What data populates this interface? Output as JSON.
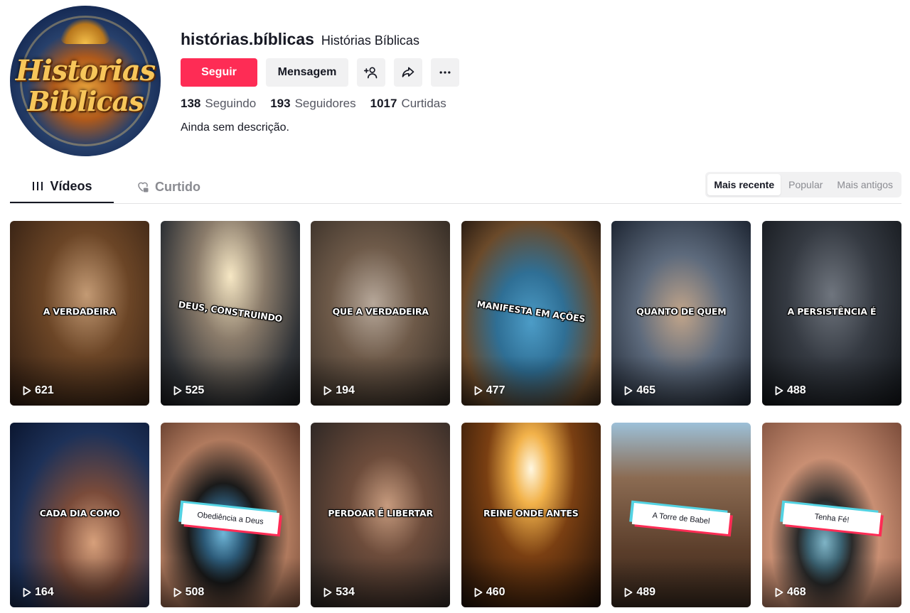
{
  "profile": {
    "username": "histórias.bíblicas",
    "nickname": "Histórias Bíblicas",
    "avatar_text_line1": "Historias",
    "avatar_text_line2": "Biblicas",
    "follow_label": "Seguir",
    "message_label": "Mensagem",
    "stats": {
      "following_count": "138",
      "following_label": "Seguindo",
      "followers_count": "193",
      "followers_label": "Seguidores",
      "likes_count": "1017",
      "likes_label": "Curtidas"
    },
    "bio": "Ainda sem descrição."
  },
  "tabs": {
    "videos": "Vídeos",
    "liked": "Curtido"
  },
  "sort": {
    "options": [
      "Mais recente",
      "Popular",
      "Mais antigos"
    ],
    "selected": "Mais recente"
  },
  "icons": {
    "add_friend": "add-friend-icon",
    "share": "share-icon",
    "more": "more-icon",
    "videos_tab": "grid-icon",
    "liked_tab": "heart-lock-icon",
    "play": "play-icon"
  },
  "colors": {
    "accent": "#fe2c55",
    "secondary_button": "#f1f1f2",
    "text_primary": "#161823",
    "text_secondary": "#8a8b91"
  },
  "videos": [
    {
      "caption": "A VERDADEIRA",
      "views": "621"
    },
    {
      "caption": "DEUS, CONSTRUINDO",
      "views": "525"
    },
    {
      "caption": "QUE A VERDADEIRA",
      "views": "194"
    },
    {
      "caption": "MANIFESTA EM AÇÕES",
      "views": "477"
    },
    {
      "caption": "QUANTO DE QUEM",
      "views": "465"
    },
    {
      "caption": "A PERSISTÊNCIA É",
      "views": "488"
    },
    {
      "caption": "CADA DIA COMO",
      "views": "164"
    },
    {
      "caption": "Obediência a Deus",
      "views": "508"
    },
    {
      "caption": "PERDOAR É LIBERTAR",
      "views": "534"
    },
    {
      "caption": "REINE ONDE ANTES",
      "views": "460"
    },
    {
      "caption": "A Torre de Babel",
      "views": "489"
    },
    {
      "caption": "Tenha Fé!",
      "views": "468"
    }
  ]
}
